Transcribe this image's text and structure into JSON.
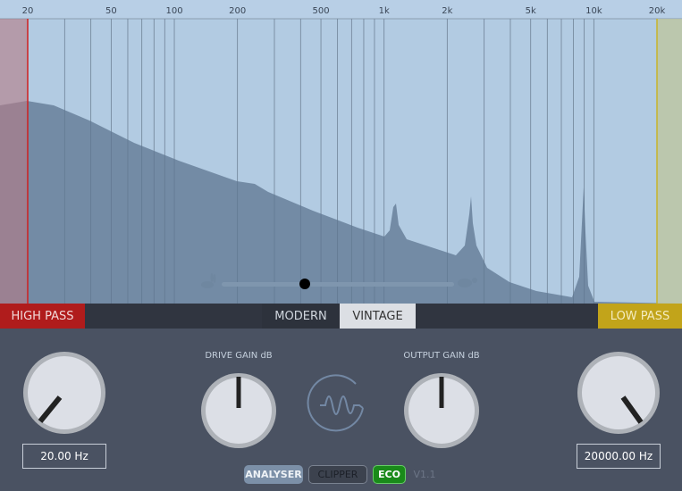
{
  "freq_labels": [
    {
      "f": 20,
      "t": "20"
    },
    {
      "f": 50,
      "t": "50"
    },
    {
      "f": 100,
      "t": "100"
    },
    {
      "f": 200,
      "t": "200"
    },
    {
      "f": 500,
      "t": "500"
    },
    {
      "f": 1000,
      "t": "1k"
    },
    {
      "f": 2000,
      "t": "2k"
    },
    {
      "f": 5000,
      "t": "5k"
    },
    {
      "f": 10000,
      "t": "10k"
    },
    {
      "f": 20000,
      "t": "20k"
    }
  ],
  "grid_freqs": [
    30,
    40,
    50,
    60,
    70,
    80,
    90,
    100,
    200,
    300,
    400,
    500,
    600,
    700,
    800,
    900,
    1000,
    2000,
    3000,
    4000,
    5000,
    6000,
    7000,
    8000,
    9000,
    10000
  ],
  "high_pass_hz": 20,
  "low_pass_hz": 20000,
  "speed_slider": 0.25,
  "filters": {
    "high_pass": "HIGH PASS",
    "low_pass": "LOW PASS"
  },
  "modes": {
    "modern": "MODERN",
    "vintage": "VINTAGE",
    "active": "vintage"
  },
  "knobs": {
    "drive_label": "DRIVE GAIN dB",
    "output_label": "OUTPUT GAIN dB"
  },
  "fields": {
    "hp_value": "20.00 Hz",
    "lp_value": "20000.00 Hz"
  },
  "footer": {
    "analyser": "ANALYSER",
    "clipper": "CLIPPER",
    "eco": "ECO",
    "version": "V1.1"
  },
  "colors": {
    "high_pass": "#b01c1c",
    "low_pass": "#c2a41a",
    "eco": "#1a8a1a"
  }
}
